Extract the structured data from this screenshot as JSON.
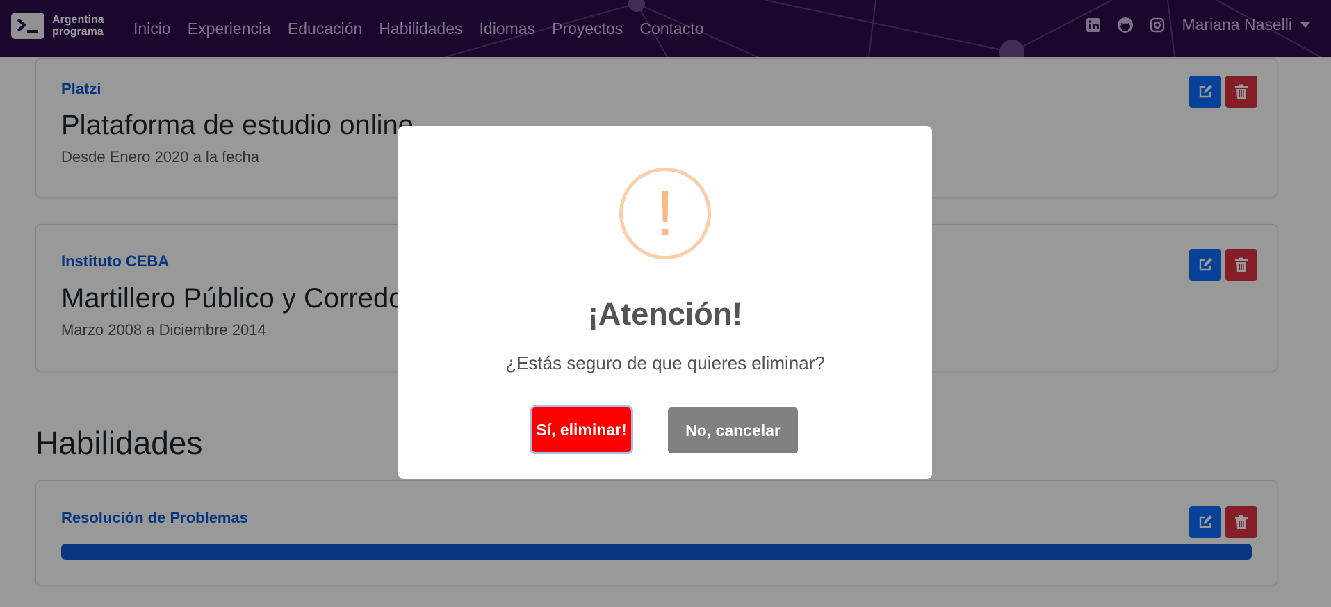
{
  "brand": {
    "line1": "Argentina",
    "line2": "programa"
  },
  "nav": {
    "links": [
      "Inicio",
      "Experiencia",
      "Educación",
      "Habilidades",
      "Idiomas",
      "Proyectos",
      "Contacto"
    ],
    "social_icons": [
      "linkedin-icon",
      "github-icon",
      "instagram-icon"
    ],
    "user": "Mariana Naselli"
  },
  "education": [
    {
      "institution": "Platzi",
      "title": "Plataforma de estudio online",
      "dates": "Desde Enero 2020 a la fecha"
    },
    {
      "institution": "Instituto CEBA",
      "title": "Martillero Público y Corredor",
      "dates": "Marzo 2008 a Diciembre 2014"
    }
  ],
  "skills": {
    "heading": "Habilidades",
    "items": [
      {
        "name": "Resolución de Problemas",
        "level_percent": 100
      }
    ]
  },
  "dialog": {
    "icon": "!",
    "title": "¡Atención!",
    "text": "¿Estás seguro de que quieres eliminar?",
    "confirm": "Sí, eliminar!",
    "cancel": "No, cancelar"
  },
  "colors": {
    "navbar": "#2d0b4e",
    "accent_blue": "#0d5ad6",
    "danger": "#dc3545",
    "confirm": "#ff0000",
    "cancel": "#808080",
    "warning": "#f8bb86"
  }
}
